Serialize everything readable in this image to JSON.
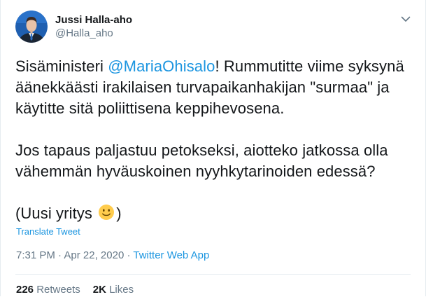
{
  "author": {
    "name": "Jussi Halla-aho",
    "handle": "@Halla_aho"
  },
  "tweet": {
    "line1_before": "Sisäministeri ",
    "mention": "@MariaOhisalo",
    "line1_after": "! Rummutitte viime syksynä äänekkäästi irakilaisen turvapaikanhakijan \"surmaa\" ja käytitte sitä poliittisena keppihevosena.",
    "paragraph2": "Jos tapaus paljastuu petokseksi, aiotteko jatkossa olla vähemmän hyväuskoinen nyyhkytarinoiden edessä?",
    "paragraph3_before": "(Uusi yritys ",
    "paragraph3_emoji": "slightly-smiling-face",
    "paragraph3_after": ")"
  },
  "translate_label": "Translate Tweet",
  "meta": {
    "time": "7:31 PM",
    "separator1": " · ",
    "date": "Apr 22, 2020",
    "separator2": " · ",
    "app": "Twitter Web App"
  },
  "stats": {
    "retweets_count": "226",
    "retweets_label": "Retweets",
    "likes_count": "2K",
    "likes_label": "Likes"
  },
  "colors": {
    "link": "#1b95e0",
    "secondary_text": "#657786",
    "primary_text": "#14171a",
    "border": "#e6ecf0"
  },
  "icons": {
    "caret": "chevron-down-icon",
    "avatar": "profile-photo"
  }
}
